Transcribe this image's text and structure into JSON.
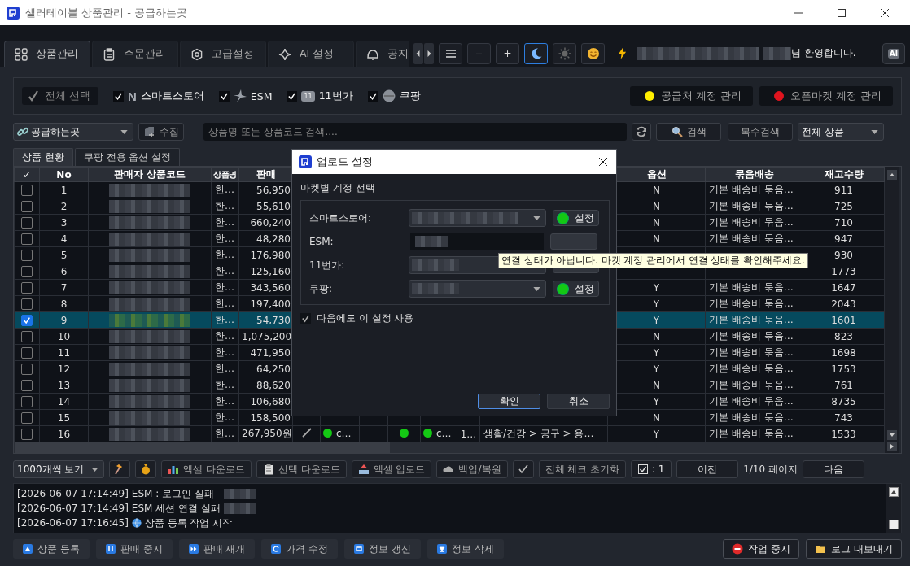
{
  "window": {
    "title": "셀러테이블 상품관리 - 공급하는곳"
  },
  "tabs": [
    {
      "label": "상품관리",
      "kind": "grid",
      "selected": true
    },
    {
      "label": "주문관리",
      "kind": "clipboard",
      "selected": false
    },
    {
      "label": "고급설정",
      "kind": "gear",
      "selected": false
    },
    {
      "label": "AI 설정",
      "kind": "sparkle",
      "selected": false
    },
    {
      "label": "공지",
      "kind": "bell",
      "selected": false
    }
  ],
  "zoom_buttons": [
    "−",
    "+"
  ],
  "theme_buttons": [
    {
      "kind": "moon",
      "selected": true
    },
    {
      "kind": "sun",
      "selected": false
    }
  ],
  "welcome": "님 환영합니다.",
  "ai_button": "AI",
  "select_all": "전체 선택",
  "markets": [
    {
      "label": "스마트스토어",
      "checked": true,
      "kind": "letter",
      "logo_text": "N"
    },
    {
      "label": "ESM",
      "checked": true,
      "kind": "spark"
    },
    {
      "label": "11번가",
      "checked": true,
      "kind": "badge",
      "logo_text": "11"
    },
    {
      "label": "쿠팡",
      "checked": true,
      "kind": "circle"
    }
  ],
  "account_buttons": [
    {
      "label": "공급처 계정 관리",
      "color": "#ffee00"
    },
    {
      "label": "오픈마켓 계정 관리",
      "color": "#e0141e"
    }
  ],
  "supplier_dropdown": "공급하는곳",
  "collect_button": "수집",
  "search": {
    "placeholder": "상품명 또는 상품코드 검색...."
  },
  "search_button": "검색",
  "multi_search_button": "복수검색",
  "filter_dropdown": "전체 상품",
  "sub_tabs": [
    {
      "label": "상품 현황",
      "selected": true
    },
    {
      "label": "쿠팡 전용 옵션 설정",
      "selected": false
    }
  ],
  "table": {
    "columns": [
      "✓",
      "No",
      "판매자 상품코드",
      "상품명",
      "판매",
      "옵션",
      "묶음배송",
      "재고수량"
    ],
    "rows": [
      {
        "no": "1",
        "selected": false,
        "name": "한…",
        "price": "56,950",
        "option": "N",
        "bundle": "기본 배송비 묶음…",
        "stock": "911"
      },
      {
        "no": "2",
        "selected": false,
        "name": "한…",
        "price": "55,610",
        "option": "N",
        "bundle": "기본 배송비 묶음…",
        "stock": "725"
      },
      {
        "no": "3",
        "selected": false,
        "name": "한…",
        "price": "660,240",
        "option": "N",
        "bundle": "기본 배송비 묶음…",
        "stock": "710"
      },
      {
        "no": "4",
        "selected": false,
        "name": "한…",
        "price": "48,280",
        "option": "N",
        "bundle": "기본 배송비 묶음…",
        "stock": "947"
      },
      {
        "no": "5",
        "selected": false,
        "name": "한…",
        "price": "176,980",
        "stock": "930"
      },
      {
        "no": "6",
        "selected": false,
        "name": "한…",
        "price": "125,160",
        "stock": "1773"
      },
      {
        "no": "7",
        "selected": false,
        "name": "한…",
        "price": "343,560",
        "option": "Y",
        "bundle": "기본 배송비 묶음…",
        "stock": "1647"
      },
      {
        "no": "8",
        "selected": false,
        "name": "한…",
        "price": "197,400",
        "option": "Y",
        "bundle": "기본 배송비 묶음…",
        "stock": "2043"
      },
      {
        "no": "9",
        "selected": true,
        "name": "한…",
        "price": "54,730",
        "option": "Y",
        "bundle": "기본 배송비 묶음…",
        "stock": "1601"
      },
      {
        "no": "10",
        "selected": false,
        "name": "한…",
        "price": "1,075,200",
        "option": "N",
        "bundle": "기본 배송비 묶음…",
        "stock": "823"
      },
      {
        "no": "11",
        "selected": false,
        "name": "한…",
        "price": "471,950",
        "option": "Y",
        "bundle": "기본 배송비 묶음…",
        "stock": "1698"
      },
      {
        "no": "12",
        "selected": false,
        "name": "한…",
        "price": "64,250",
        "option": "Y",
        "bundle": "기본 배송비 묶음…",
        "stock": "1753"
      },
      {
        "no": "13",
        "selected": false,
        "name": "한…",
        "price": "88,620",
        "option": "N",
        "bundle": "기본 배송비 묶음…",
        "stock": "761"
      },
      {
        "no": "14",
        "selected": false,
        "name": "한…",
        "price": "106,680",
        "option": "Y",
        "bundle": "기본 배송비 묶음…",
        "stock": "8735"
      },
      {
        "no": "15",
        "selected": false,
        "name": "한…",
        "price": "158,500",
        "option": "N",
        "bundle": "기본 배송비 묶음…",
        "stock": "743"
      },
      {
        "no": "16",
        "selected": false,
        "name": "한…",
        "price": "267,950원",
        "detail": [
          {
            "dot": true,
            "text": "c…"
          },
          {
            "dot": true
          },
          {
            "dot": true,
            "text": "c…"
          },
          {
            "text": "1…"
          }
        ],
        "category": "생활/건강 > 공구 > 용…",
        "option": "Y",
        "bundle": "기본 배송비 묶음…",
        "stock": "1533"
      }
    ]
  },
  "page_size_dropdown": "1000개씩 보기",
  "toolbar_buttons": [
    {
      "label": "엑셀 다운로드",
      "kind": "chart"
    },
    {
      "label": "선택 다운로드",
      "kind": "clipboard"
    },
    {
      "label": "엑셀 업로드",
      "kind": "upload"
    },
    {
      "label": "백업/복원",
      "kind": "cloud"
    }
  ],
  "reset_button": "전체 체크 초기화",
  "checked_count": ": 1",
  "prev_button": "이전",
  "page_indicator": "1/10 페이지",
  "next_button": "다음",
  "log": [
    {
      "time": "[2026-06-07 17:14:49]",
      "text": "ESM : 로그인 실패 -",
      "redacted": true
    },
    {
      "time": "[2026-06-07 17:14:49]",
      "text": "ESM 세션 연결 실패",
      "redacted": true
    },
    {
      "time": "[2026-06-07 17:16:45]",
      "text": "상품 등록 작업 시작",
      "kind": "globe"
    }
  ],
  "actions": [
    {
      "label": "상품 등록",
      "kind": "up"
    },
    {
      "label": "판매 중지",
      "kind": "pause"
    },
    {
      "label": "판매 재개",
      "kind": "forward"
    },
    {
      "label": "가격 수정",
      "kind": "refresh"
    },
    {
      "label": "정보 갱신",
      "kind": "sync"
    },
    {
      "label": "정보 삭제",
      "kind": "down"
    }
  ],
  "right_actions": [
    {
      "label": "작업 중지",
      "kind": "stop"
    },
    {
      "label": "로그 내보내기",
      "kind": "folder"
    }
  ],
  "dialog": {
    "title": "업로드 설정",
    "section": "마켓별 계정 선택",
    "rows": [
      {
        "label": "스마트스토어:",
        "kind": "dropdown",
        "connected": true,
        "button": "설정"
      },
      {
        "label": "ESM:",
        "kind": "text",
        "connected": false
      },
      {
        "label": "11번가:",
        "kind": "dropdown",
        "connected": false
      },
      {
        "label": "쿠팡:",
        "kind": "dropdown",
        "connected": true,
        "button": "설정"
      }
    ],
    "remember": {
      "label": "다음에도 이 설정 사용",
      "checked": true
    },
    "ok_button": "확인",
    "cancel_button": "취소"
  },
  "tooltip": "연결 상태가 아닙니다. 마켓 계정 관리에서 연결 상태를 확인해주세요."
}
